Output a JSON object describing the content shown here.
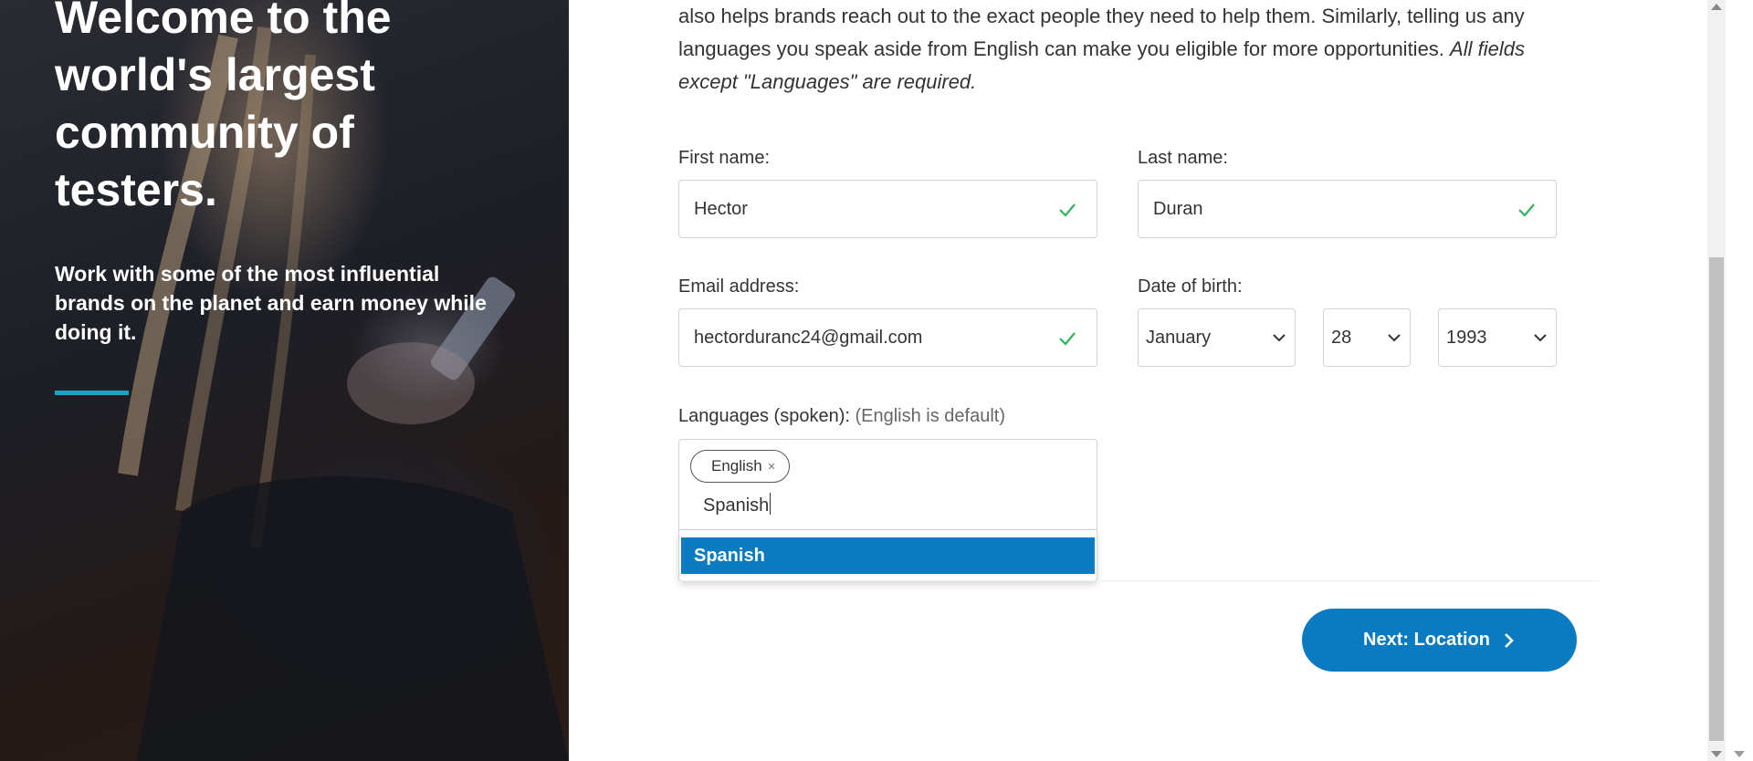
{
  "hero": {
    "title": "Welcome to the world's largest community of testers.",
    "subtitle": "Work with some of the most influential brands on the planet and earn money while doing it.",
    "accent_color": "#1aa3c7"
  },
  "intro": {
    "line1": "also helps brands reach out to the exact people they need to help them. Similarly, telling us any languages you speak aside from English can make you eligible for more opportunities. ",
    "italic_note": "All fields except \"Languages\" are required."
  },
  "form": {
    "first_name": {
      "label": "First name:",
      "value": "Hector",
      "valid": true
    },
    "last_name": {
      "label": "Last name:",
      "value": "Duran",
      "valid": true
    },
    "email": {
      "label": "Email address:",
      "value": "hectorduranc24@gmail.com",
      "valid": true
    },
    "dob": {
      "label": "Date of birth:",
      "month": "January",
      "day": "28",
      "year": "1993"
    },
    "languages": {
      "label": "Languages (spoken):",
      "hint": "(English is default)",
      "chips": [
        "English"
      ],
      "chip_remove": "×",
      "typed": "Spanish",
      "suggestions": [
        "Spanish"
      ]
    }
  },
  "actions": {
    "next_label": "Next: Location",
    "primary_color": "#0a7ac1"
  },
  "icons": {
    "check": "check-icon",
    "chevron_down": "chevron-down-icon",
    "chevron_right": "chevron-right-icon"
  },
  "colors": {
    "valid_check": "#2db35d",
    "selected_option_bg": "#0a7ac1"
  }
}
